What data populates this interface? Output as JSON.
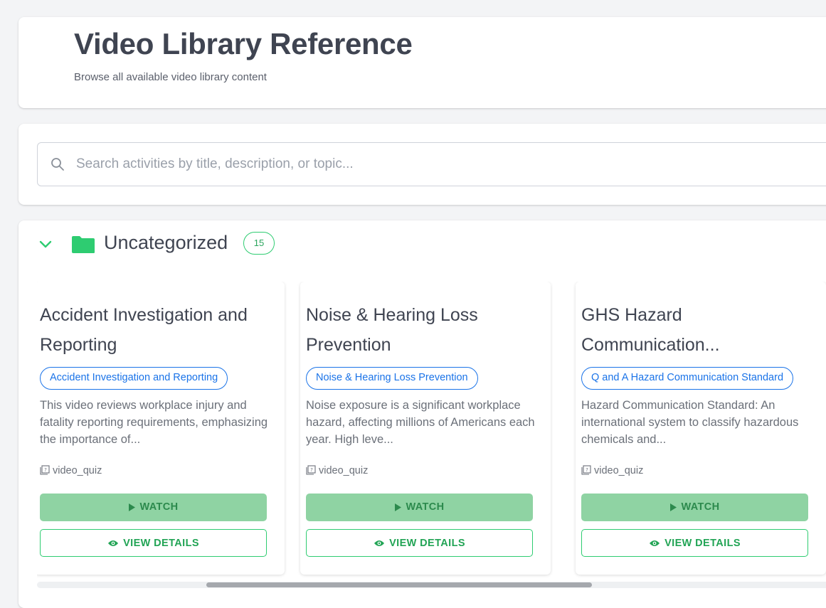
{
  "header": {
    "title": "Video Library Reference",
    "subtitle": "Browse all available video library content"
  },
  "search": {
    "placeholder": "Search activities by title, description, or topic...",
    "value": ""
  },
  "category": {
    "name": "Uncategorized",
    "count": "15",
    "expanded": true,
    "accent_color": "#2ecc71"
  },
  "cards": [
    {
      "title": "Accident Investigation and Reporting",
      "tag": "Accident Investigation and Reporting",
      "description": "This video reviews workplace injury and fatality reporting requirements, emphasizing the importance of...",
      "type": "video_quiz",
      "watch_label": "WATCH",
      "details_label": "VIEW DETAILS"
    },
    {
      "title": "Noise & Hearing Loss Prevention",
      "tag": "Noise & Hearing Loss Prevention",
      "description": "Noise exposure is a significant workplace hazard, affecting millions of Americans each year. High leve...",
      "type": "video_quiz",
      "watch_label": "WATCH",
      "details_label": "VIEW DETAILS"
    },
    {
      "title": "GHS Hazard Communication...",
      "tag": "Q and A Hazard Communication Standard",
      "description": "Hazard Communication Standard: An international system to classify hazardous chemicals and...",
      "type": "video_quiz",
      "watch_label": "WATCH",
      "details_label": "VIEW DETAILS"
    }
  ],
  "colors": {
    "tag_blue": "#1a73e8",
    "watch_bg": "#8fd3a3",
    "green": "#2ecc71"
  }
}
